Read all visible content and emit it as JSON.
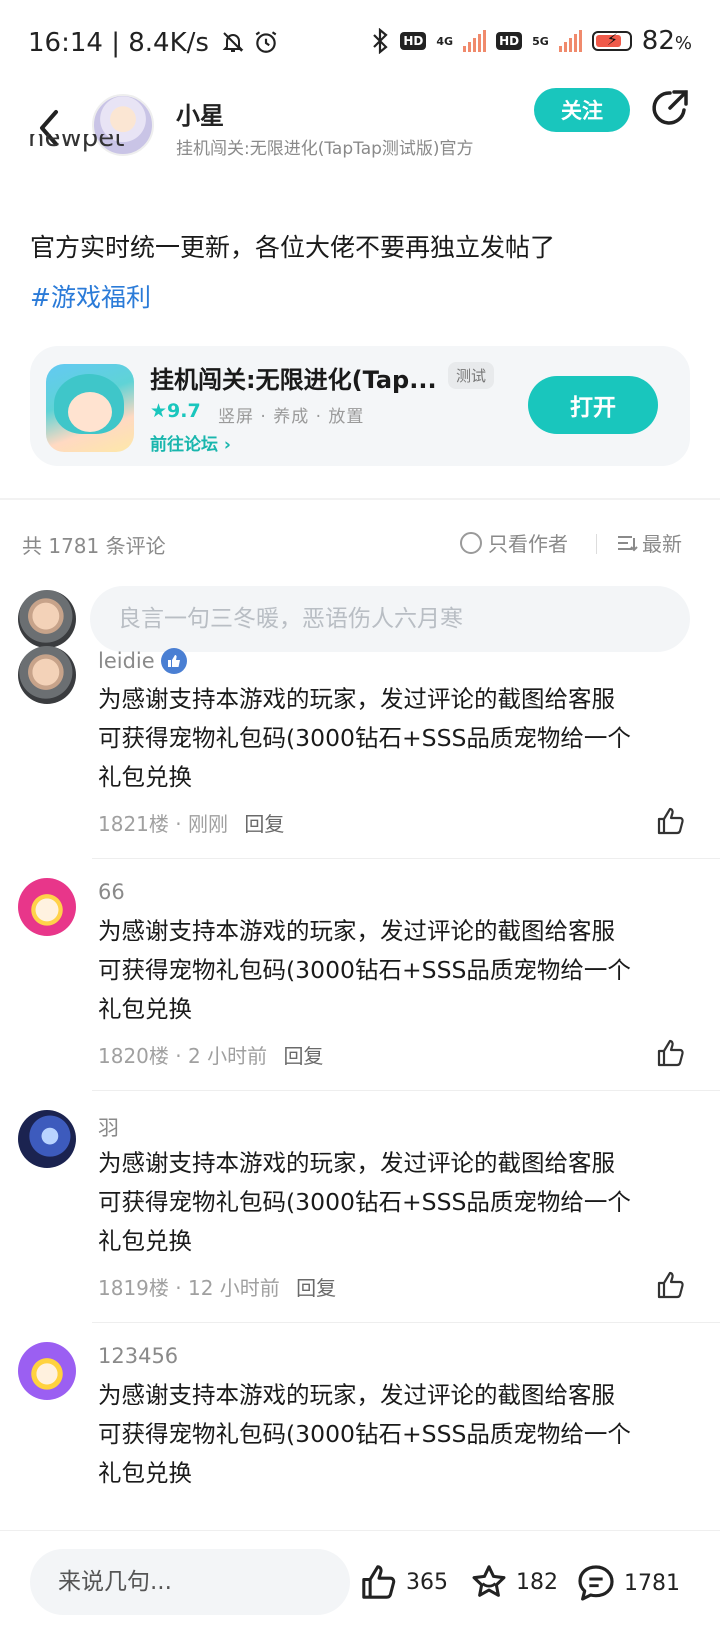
{
  "status_bar": {
    "time": "16:14",
    "speed": "8.4K/s",
    "net1": "4G",
    "net2": "5G",
    "hd": "HD",
    "battery": "82",
    "battery_unit": "%",
    "icons": [
      "mute-bell-icon",
      "alarm-icon",
      "bluetooth-icon",
      "signal-icon",
      "battery-icon"
    ]
  },
  "header": {
    "name": "小星",
    "subtitle": "挂机闯关:无限进化(TapTap测试版)官方",
    "follow_label": "关注"
  },
  "post": {
    "cut_text": "newpet",
    "text": "官方实时统一更新，各位大佬不要再独立发帖了",
    "tag": "#游戏福利"
  },
  "game_card": {
    "title": "挂机闯关:无限进化(Tap...",
    "badge": "测试",
    "rating": "9.7",
    "tags": "竖屏 · 养成 · 放置",
    "forum_link": "前往论坛",
    "open_label": "打开"
  },
  "comments_header": {
    "total": "共 1781 条评论",
    "only_author": "只看作者",
    "sort": "最新",
    "input_placeholder": "良言一句三冬暖，恶语伤人六月寒"
  },
  "comments": [
    {
      "user": "leidie",
      "line1": "为感谢支持本游戏的玩家，发过评论的截图给客服",
      "line2": "可获得宠物礼包码(3000钻石+SSS品质宠物给一个",
      "line3": "礼包兑换",
      "floor": "1821楼",
      "time": "刚刚",
      "reply": "回复"
    },
    {
      "user": "66",
      "line1": "为感谢支持本游戏的玩家，发过评论的截图给客服",
      "line2": "可获得宠物礼包码(3000钻石+SSS品质宠物给一个",
      "line3": "礼包兑换",
      "floor": "1820楼",
      "time": "2 小时前",
      "reply": "回复"
    },
    {
      "user": "羽",
      "line1": "为感谢支持本游戏的玩家，发过评论的截图给客服",
      "line2": "可获得宠物礼包码(3000钻石+SSS品质宠物给一个",
      "line3": "礼包兑换",
      "floor": "1819楼",
      "time": "12 小时前",
      "reply": "回复"
    },
    {
      "user": "123456",
      "line1": "为感谢支持本游戏的玩家，发过评论的截图给客服",
      "line2": "可获得宠物礼包码(3000钻石+SSS品质宠物给一个",
      "line3": "礼包兑换"
    }
  ],
  "bottom_bar": {
    "input_placeholder": "来说几句...",
    "likes": "365",
    "stars": "182",
    "comments": "1781"
  },
  "colors": {
    "accent": "#19c6bd",
    "tag_blue": "#2b7bd8"
  }
}
